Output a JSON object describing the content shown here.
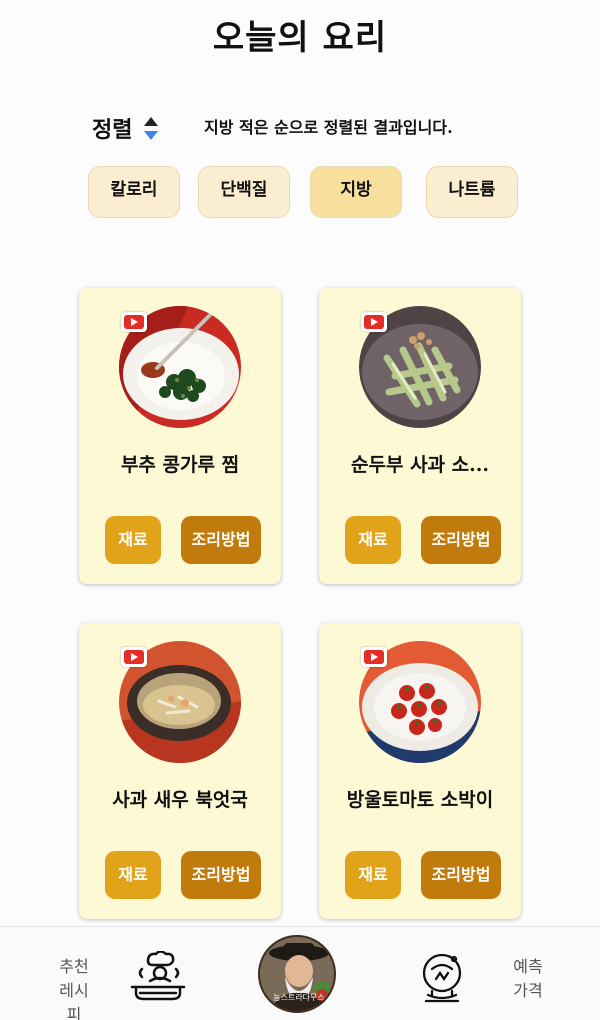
{
  "header": {
    "title": "오늘의 요리"
  },
  "sort": {
    "label": "정렬",
    "description": "지방 적은 순으로 정렬된 결과입니다."
  },
  "filters": [
    {
      "label": "칼로리",
      "active": false
    },
    {
      "label": "단백질",
      "active": false
    },
    {
      "label": "지방",
      "active": true
    },
    {
      "label": "나트륨",
      "active": false
    }
  ],
  "recipes": [
    {
      "name": "부추 콩가루 찜",
      "ingredients_label": "재료",
      "method_label": "조리방법"
    },
    {
      "name": "순두부 사과 소...",
      "ingredients_label": "재료",
      "method_label": "조리방법"
    },
    {
      "name": "사과 새우 북엇국",
      "ingredients_label": "재료",
      "method_label": "조리방법"
    },
    {
      "name": "방울토마토 소박이",
      "ingredients_label": "재료",
      "method_label": "조리방법"
    }
  ],
  "bottom_nav": {
    "left_label_line1": "추천",
    "left_label_line2": "레시피",
    "center_logo_text": "농스트라다무스",
    "right_label_line1": "예측",
    "right_label_line2": "가격"
  },
  "colors": {
    "card_bg": "#fef9d5",
    "chip_bg": "#fbedcf",
    "chip_active_bg": "#f9df9e",
    "ingredients_button": "#e0a31a",
    "method_button": "#c07b0c",
    "sort_arrow_active": "#3b86f2"
  }
}
